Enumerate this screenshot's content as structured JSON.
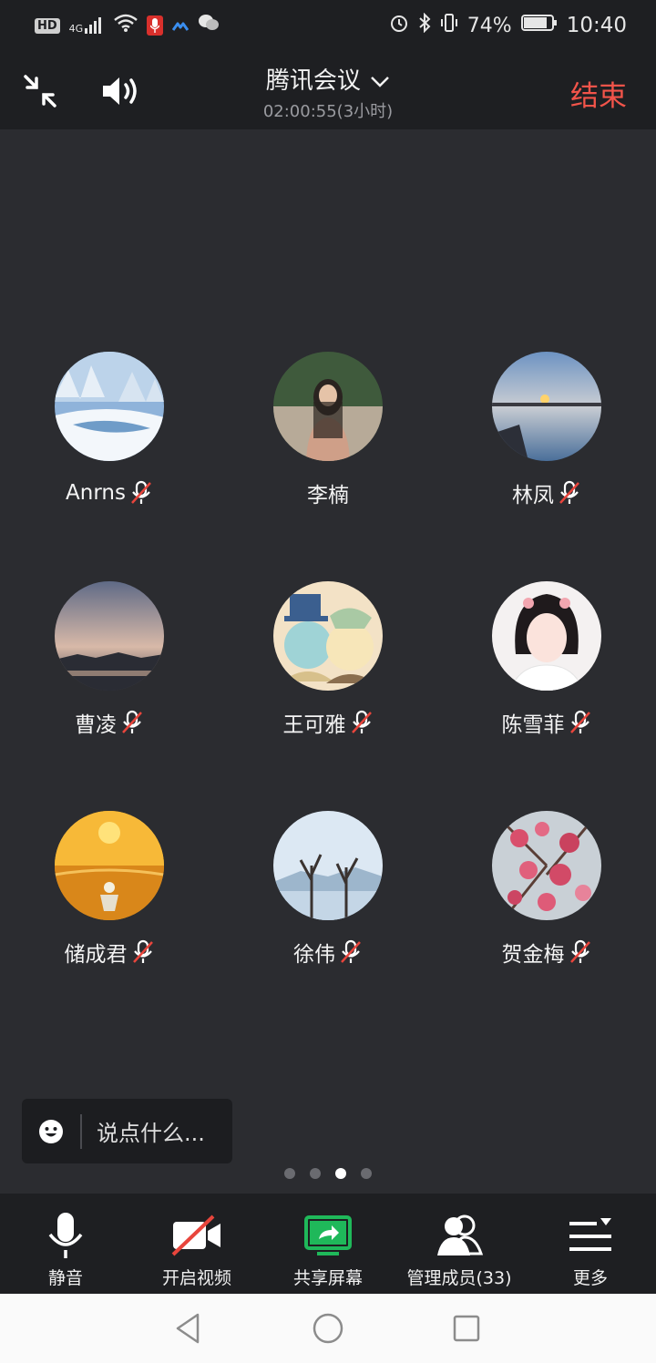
{
  "status_bar": {
    "left_icons": [
      "hd-icon",
      "4g-signal-icon",
      "wifi-icon",
      "mic-recording-icon",
      "app-icon",
      "wechat-icon"
    ],
    "hd": "HD",
    "net": "4G",
    "battery_pct": "74%",
    "time": "10:40"
  },
  "header": {
    "title": "腾讯会议",
    "elapsed": "02:00:55(3小时)",
    "end_label": "结束"
  },
  "participants": [
    {
      "name": "Anrns",
      "muted": true,
      "avatar": "snowy-river"
    },
    {
      "name": "李楠",
      "muted": false,
      "avatar": "woman-photo"
    },
    {
      "name": "林凤",
      "muted": true,
      "avatar": "sunset-lake"
    },
    {
      "name": "曹凌",
      "muted": true,
      "avatar": "dusk-sky"
    },
    {
      "name": "王可雅",
      "muted": true,
      "avatar": "cartoon-characters"
    },
    {
      "name": "陈雪菲",
      "muted": true,
      "avatar": "selfie-girl"
    },
    {
      "name": "储成君",
      "muted": true,
      "avatar": "golden-field-sun"
    },
    {
      "name": "徐伟",
      "muted": true,
      "avatar": "bare-trees-lake"
    },
    {
      "name": "贺金梅",
      "muted": true,
      "avatar": "pink-blossoms"
    }
  ],
  "chat": {
    "placeholder": "说点什么..."
  },
  "pagination": {
    "total": 4,
    "active": 3
  },
  "toolbar": [
    {
      "label": "静音",
      "icon": "microphone-icon"
    },
    {
      "label": "开启视频",
      "icon": "video-off-icon"
    },
    {
      "label": "共享屏幕",
      "icon": "share-screen-icon"
    },
    {
      "label": "管理成员(33)",
      "icon": "members-icon"
    },
    {
      "label": "更多",
      "icon": "more-menu-icon"
    }
  ],
  "colors": {
    "end": "#f2544a",
    "share": "#1fb85a",
    "mute_slash": "#e8453c"
  }
}
